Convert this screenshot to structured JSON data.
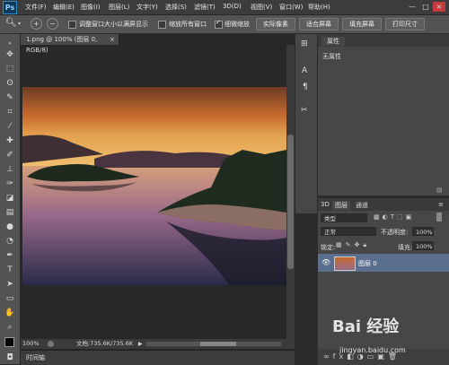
{
  "app": {
    "logo": "Ps"
  },
  "menu": [
    "文件(F)",
    "编辑(E)",
    "图像(I)",
    "图层(L)",
    "文字(Y)",
    "选择(S)",
    "滤镜(T)",
    "3D(D)",
    "视图(V)",
    "窗口(W)",
    "帮助(H)"
  ],
  "window_controls": [
    "—",
    "□",
    "×"
  ],
  "options": {
    "resize_windows": "调整窗口大小以满屏显示",
    "zoom_all": "缩放所有窗口",
    "scrubby_zoom": "细微缩放",
    "actual_pixels": "实际像素",
    "fit_screen": "适合屏幕",
    "fill_screen": "填充屏幕",
    "print_size": "打印尺寸"
  },
  "document": {
    "tab_title": "1.png @ 100% (图层 0, RGB/8)",
    "tab_close": "×",
    "zoom": "100%",
    "doc_size": "文档:735.6K/735.6K"
  },
  "timeline": {
    "label": "时间轴"
  },
  "properties": {
    "tab": "属性",
    "content": "无属性"
  },
  "layers_panel": {
    "tabs": [
      "3D",
      "图层",
      "通道"
    ],
    "filter": "类型",
    "blend_mode": "正常",
    "opacity_label": "不透明度:",
    "opacity": "100%",
    "lock_label": "锁定:",
    "fill_label": "填充:",
    "fill": "100%",
    "layers": [
      {
        "name": "图层 0"
      }
    ]
  },
  "watermark": {
    "text": "Bai 经验",
    "url": "jingyan.baidu.com"
  },
  "colors": {
    "accent": "#2c8ac6",
    "selected_layer": "#5a6f8e"
  }
}
